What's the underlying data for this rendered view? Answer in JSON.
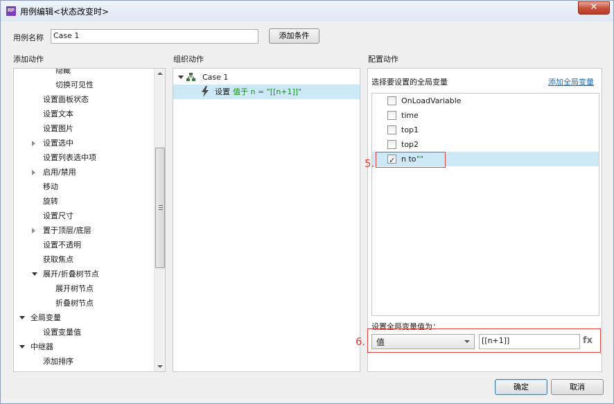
{
  "window": {
    "title": "用例编辑<状态改变时>",
    "app_icon": "RP"
  },
  "case_name": {
    "label": "用例名称",
    "value": "Case 1",
    "add_condition": "添加条件"
  },
  "add_actions": {
    "heading": "添加动作",
    "items": [
      {
        "label": "隐藏",
        "indent": 3,
        "toggle": "none"
      },
      {
        "label": "切换可见性",
        "indent": 3,
        "toggle": "none"
      },
      {
        "label": "设置面板状态",
        "indent": 2,
        "toggle": "none"
      },
      {
        "label": "设置文本",
        "indent": 2,
        "toggle": "none"
      },
      {
        "label": "设置图片",
        "indent": 2,
        "toggle": "none"
      },
      {
        "label": "设置选中",
        "indent": 2,
        "toggle": "collapsed"
      },
      {
        "label": "设置列表选中项",
        "indent": 2,
        "toggle": "none"
      },
      {
        "label": "启用/禁用",
        "indent": 2,
        "toggle": "collapsed"
      },
      {
        "label": "移动",
        "indent": 2,
        "toggle": "none"
      },
      {
        "label": "旋转",
        "indent": 2,
        "toggle": "none"
      },
      {
        "label": "设置尺寸",
        "indent": 2,
        "toggle": "none"
      },
      {
        "label": "置于顶层/底层",
        "indent": 2,
        "toggle": "collapsed"
      },
      {
        "label": "设置不透明",
        "indent": 2,
        "toggle": "none"
      },
      {
        "label": "获取焦点",
        "indent": 2,
        "toggle": "none"
      },
      {
        "label": "展开/折叠树节点",
        "indent": 2,
        "toggle": "expanded"
      },
      {
        "label": "展开树节点",
        "indent": 3,
        "toggle": "none"
      },
      {
        "label": "折叠树节点",
        "indent": 3,
        "toggle": "none"
      },
      {
        "label": "全局变量",
        "indent": 1,
        "toggle": "expanded"
      },
      {
        "label": "设置变量值",
        "indent": 2,
        "toggle": "none"
      },
      {
        "label": "中继器",
        "indent": 1,
        "toggle": "expanded"
      },
      {
        "label": "添加排序",
        "indent": 2,
        "toggle": "none"
      }
    ]
  },
  "organize_actions": {
    "heading": "组织动作",
    "case_label": "Case 1",
    "action_prefix": "设置",
    "action_detail": "值于 n = \"[[n+1]]\""
  },
  "configure_actions": {
    "heading": "配置动作",
    "select_label": "选择要设置的全局变量",
    "add_variable_link": "添加全局变量",
    "variables": [
      {
        "name": "OnLoadVariable",
        "checked": false
      },
      {
        "name": "time",
        "checked": false
      },
      {
        "name": "top1",
        "checked": false
      },
      {
        "name": "top2",
        "checked": false
      },
      {
        "name": "n to",
        "value": "\"\"",
        "checked": true
      }
    ],
    "set_value_label": "设置全局变量值为：",
    "value_type": "值",
    "value_text": "[[n+1]]",
    "fx_label": "fx"
  },
  "annotations": {
    "step5": "5.",
    "step6": "6."
  },
  "footer": {
    "ok": "确定",
    "cancel": "取消"
  },
  "colors": {
    "annotation_red": "#e0403a",
    "highlight_blue": "#cde8f7",
    "action_green": "#168c16",
    "link_blue": "#1b6fb8"
  }
}
